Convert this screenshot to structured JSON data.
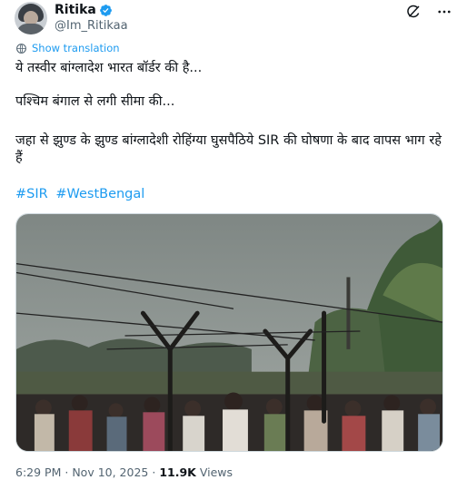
{
  "author": {
    "display_name": "Ritika",
    "handle": "@Im_Ritikaa",
    "verified": true
  },
  "actions": {
    "grok_icon": "grok-icon",
    "more_icon": "more-icon"
  },
  "translate_label": "Show translation",
  "tweet": {
    "line1": "ये तस्वीर बांग्लादेश भारत बॉर्डर की है...",
    "line2": "पश्चिम बंगाल से लगी सीमा की...",
    "line3": "जहा से झुण्ड के झुण्ड बांग्लादेशी रोहिंग्या घुसपैठिये SIR की घोषणा के बाद वापस भाग रहे हैं",
    "hashtags": [
      "#SIR",
      "#WestBengal"
    ]
  },
  "meta": {
    "time": "6:29 PM",
    "separator": "·",
    "date": "Nov 10, 2025",
    "views_count": "11.9K",
    "views_label": "Views"
  },
  "colors": {
    "accent": "#1d9bf0",
    "text": "#0f1419",
    "secondary": "#536471"
  }
}
